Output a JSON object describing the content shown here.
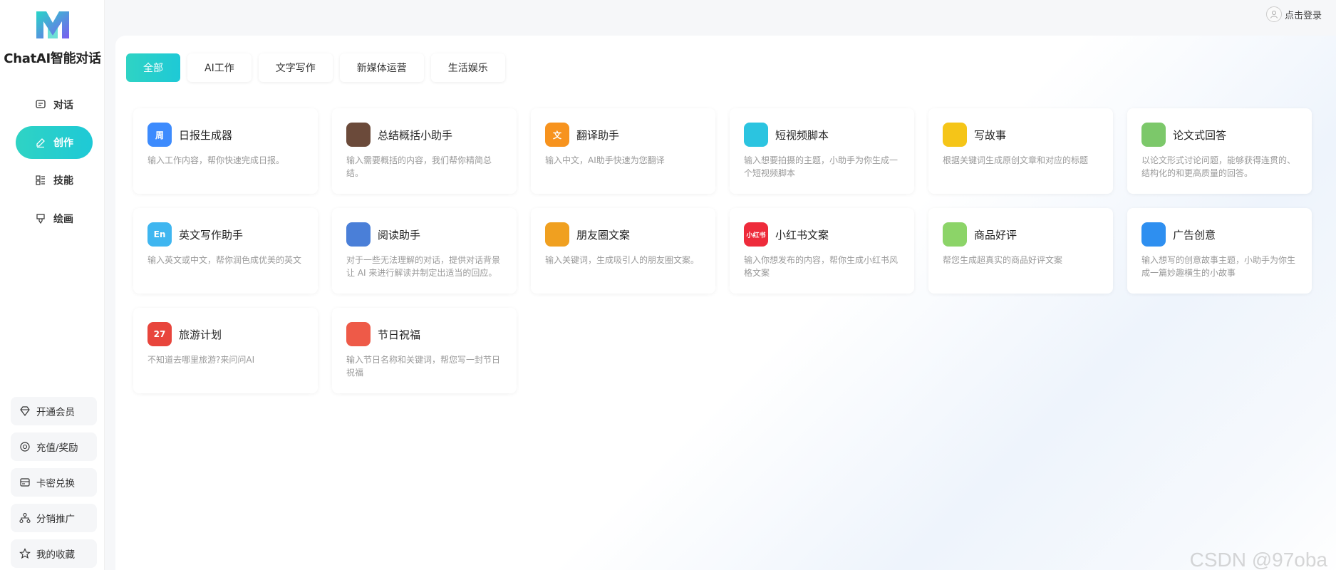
{
  "brand": {
    "name": "ChatAI智能对话",
    "accent": "#1ec9d6"
  },
  "nav": [
    {
      "label": "对话",
      "icon": "chat-icon",
      "active": false
    },
    {
      "label": "创作",
      "icon": "pen-icon",
      "active": true
    },
    {
      "label": "技能",
      "icon": "list-icon",
      "active": false
    },
    {
      "label": "绘画",
      "icon": "brush-icon",
      "active": false
    }
  ],
  "side_buttons": [
    {
      "label": "开通会员",
      "icon": "diamond-icon"
    },
    {
      "label": "充值/奖励",
      "icon": "coin-icon"
    },
    {
      "label": "卡密兑换",
      "icon": "card-icon"
    },
    {
      "label": "分销推广",
      "icon": "network-icon"
    },
    {
      "label": "我的收藏",
      "icon": "star-icon"
    }
  ],
  "login": {
    "label": "点击登录"
  },
  "tabs": [
    {
      "label": "全部",
      "active": true
    },
    {
      "label": "AI工作",
      "active": false
    },
    {
      "label": "文字写作",
      "active": false
    },
    {
      "label": "新媒体运营",
      "active": false
    },
    {
      "label": "生活娱乐",
      "active": false
    }
  ],
  "cards": [
    {
      "title": "日报生成器",
      "desc": "输入工作内容，帮你快速完成日报。",
      "icon": "daily-report-icon",
      "color": "#3d8bfd",
      "glyph": "周"
    },
    {
      "title": "总结概括小助手",
      "desc": "输入需要概括的内容，我们帮你精简总结。",
      "icon": "briefcase-icon",
      "color": "#6b4a3a",
      "glyph": ""
    },
    {
      "title": "翻译助手",
      "desc": "输入中文，AI助手快速为您翻译",
      "icon": "translate-icon",
      "color": "#f7931e",
      "glyph": "文"
    },
    {
      "title": "短视频脚本",
      "desc": "输入想要拍摄的主题，小助手为你生成一个短视频脚本",
      "icon": "clapperboard-icon",
      "color": "#2bc4e0",
      "glyph": ""
    },
    {
      "title": "写故事",
      "desc": "根据关键词生成原创文章和对应的标题",
      "icon": "notepad-icon",
      "color": "#f5c518",
      "glyph": ""
    },
    {
      "title": "论文式回答",
      "desc": "以论文形式讨论问题，能够获得连贯的、结构化的和更高质量的回答。",
      "icon": "binders-icon",
      "color": "#7cc86a",
      "glyph": ""
    },
    {
      "title": "英文写作助手",
      "desc": "输入英文或中文，帮你润色成优美的英文",
      "icon": "english-icon",
      "color": "#3fb6f0",
      "glyph": "En"
    },
    {
      "title": "阅读助手",
      "desc": "对于一些无法理解的对话，提供对话背景让 AI 来进行解读并制定出适当的回应。",
      "icon": "books-icon",
      "color": "#4a7fd8",
      "glyph": ""
    },
    {
      "title": "朋友圈文案",
      "desc": "输入关键词，生成吸引人的朋友圈文案。",
      "icon": "aperture-icon",
      "color": "#f0a020",
      "glyph": ""
    },
    {
      "title": "小红书文案",
      "desc": "输入你想发布的内容，帮你生成小红书风格文案",
      "icon": "xiaohongshu-icon",
      "color": "#ee2b3b",
      "glyph": "小红书"
    },
    {
      "title": "商品好评",
      "desc": "帮您生成超真实的商品好评文案",
      "icon": "shopping-bag-icon",
      "color": "#8cd468",
      "glyph": ""
    },
    {
      "title": "广告创意",
      "desc": "输入想写的创意故事主题，小助手为你生成一篇妙趣横生的小故事",
      "icon": "lightbulb-icon",
      "color": "#2e8ff0",
      "glyph": ""
    },
    {
      "title": "旅游计划",
      "desc": "不知道去哪里旅游?来问问AI",
      "icon": "calendar-icon",
      "color": "#e8453c",
      "glyph": "27"
    },
    {
      "title": "节日祝福",
      "desc": "输入节日名称和关键词，帮您写一封节日祝福",
      "icon": "gift-icon",
      "color": "#ee5a48",
      "glyph": ""
    }
  ],
  "watermark": "CSDN @97oba"
}
